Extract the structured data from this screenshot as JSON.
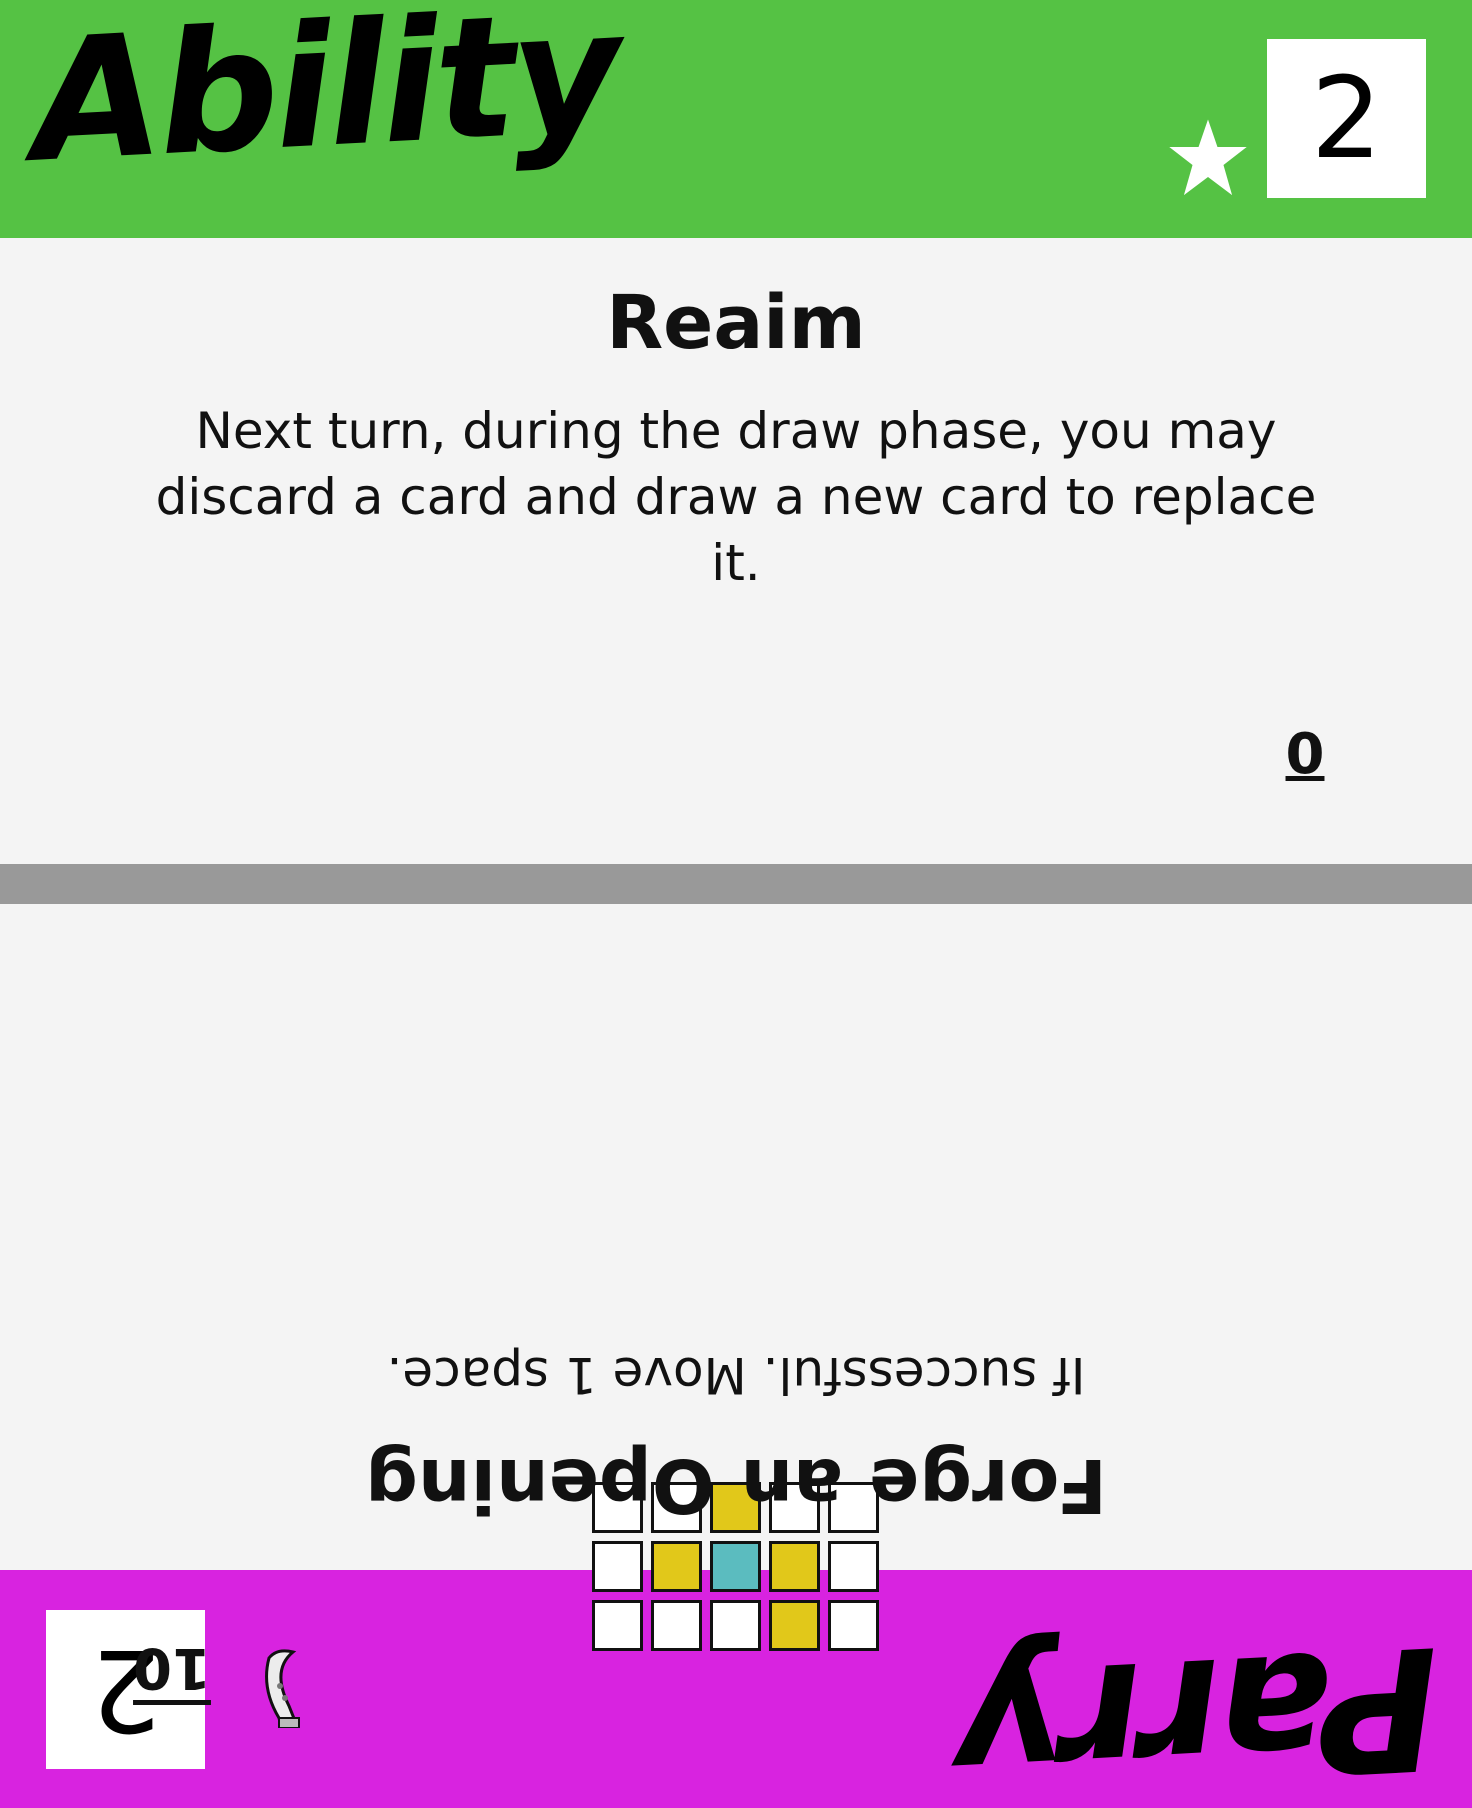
{
  "top_card": {
    "type_label": "Ability",
    "band_color": "#55c244",
    "cost": "2",
    "icon": "star-icon",
    "title": "Reaim",
    "description": "Next turn, during the draw phase, you may discard a card and draw a new card to replace it.",
    "value": "0"
  },
  "bottom_card": {
    "type_label": "Parry",
    "band_color": "#d823e0",
    "cost": "2",
    "icon": "blade-icon",
    "title": "Forge an Opening",
    "description": "If successful. Move 1 space.",
    "value": "10",
    "pattern": [
      [
        "empty",
        "yellow",
        "empty",
        "empty",
        "empty"
      ],
      [
        "empty",
        "yellow",
        "teal",
        "yellow",
        "empty"
      ],
      [
        "empty",
        "empty",
        "yellow",
        "empty",
        "empty"
      ]
    ],
    "pattern_colors": {
      "empty": "#ffffff",
      "yellow": "#e1c81a",
      "teal": "#5bbcbf"
    }
  },
  "divider_color": "#999999"
}
